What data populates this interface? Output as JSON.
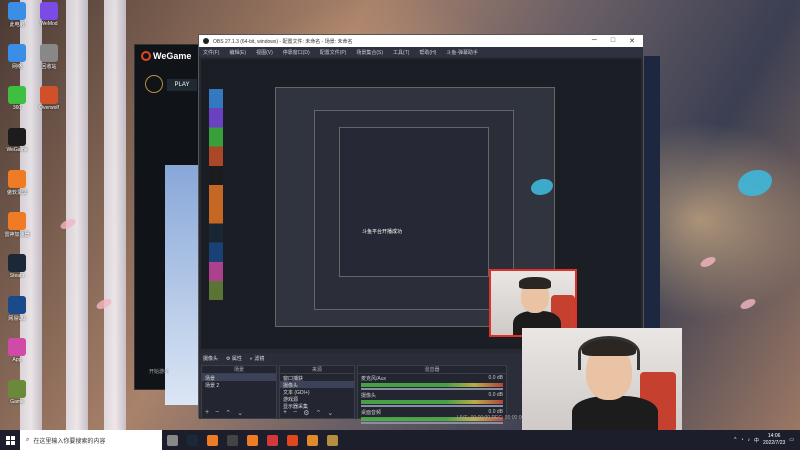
{
  "desktop": {
    "icons": [
      {
        "label": "此电脑",
        "icon": "computer-icon",
        "color": "#3a8ee6"
      },
      {
        "label": "WeMod",
        "icon": "wemod-icon",
        "color": "#7b4be6"
      },
      {
        "label": "网络",
        "icon": "network-icon",
        "color": "#3a8ee6"
      },
      {
        "label": "回收站",
        "icon": "recycle-bin-icon",
        "color": "#888"
      },
      {
        "label": "360",
        "icon": "security-icon",
        "color": "#3fbf3f"
      },
      {
        "label": "Overwolf",
        "icon": "overwolf-icon",
        "color": "#d0502a"
      },
      {
        "label": "WeGame",
        "icon": "wegame-icon",
        "color": "#1c1c1c"
      },
      {
        "label": "傲软录屏",
        "icon": "recorder-icon",
        "color": "#ef7b24"
      },
      {
        "label": "雷神加速器",
        "icon": "booster-icon",
        "color": "#ef7b24"
      },
      {
        "label": "Steam",
        "icon": "steam-icon",
        "color": "#1b2838"
      },
      {
        "label": "网易UU",
        "icon": "uu-icon",
        "color": "#1a4a8a"
      },
      {
        "label": "App",
        "icon": "app-icon",
        "color": "#d04aa8"
      },
      {
        "label": "Game",
        "icon": "game-icon",
        "color": "#6a8a3a"
      }
    ]
  },
  "wegame": {
    "logo": "WeGame",
    "play_label": "PLAY",
    "footer": "开始游戏"
  },
  "obs": {
    "title": "OBS 27.1.3 (64-bit, windows) - 配置文件: 未命名 - 场景: 未命名",
    "menu": [
      "文件(F)",
      "编辑(E)",
      "视图(V)",
      "停靠窗口(D)",
      "配置文件(P)",
      "场景集合(S)",
      "工具(T)",
      "帮助(H)",
      "斗鱼-弹幕助手"
    ],
    "source_name": "摄像头",
    "toolbar": {
      "properties": "属性",
      "filters": "滤镜"
    },
    "scenes_header": "场景",
    "scenes": [
      "场景",
      "场景 2"
    ],
    "sources_header": "来源",
    "sources": [
      "窗口捕获",
      "摄像头",
      "文本 (GDI+)",
      "游戏源",
      "显示器采集"
    ],
    "mixer_header": "混音器",
    "mixer": [
      {
        "name": "麦克风/Aux",
        "db": "0.0 dB"
      },
      {
        "name": "摄像头",
        "db": "0.0 dB"
      },
      {
        "name": "桌面音频",
        "db": "0.0 dB"
      }
    ],
    "status": "LIVE: 00:00:00  REC: 00:00:00  CPU: 2.3%, 30.00 fps",
    "nested_toast": "斗鱼平台开播成功"
  },
  "taskbar": {
    "search_placeholder": "在这里输入你要搜索的内容",
    "apps": [
      {
        "icon": "task-view-icon",
        "color": "#888"
      },
      {
        "icon": "steam-icon",
        "color": "#1b2838"
      },
      {
        "icon": "booster-icon",
        "color": "#ef7b24"
      },
      {
        "icon": "obs-icon",
        "color": "#444"
      },
      {
        "icon": "recorder-icon",
        "color": "#ef7b24"
      },
      {
        "icon": "browser-icon",
        "color": "#d6383a"
      },
      {
        "icon": "wegame-icon",
        "color": "#e2461c"
      },
      {
        "icon": "game-launcher-icon",
        "color": "#e08a2a"
      },
      {
        "icon": "lol-icon",
        "color": "#b58f3e"
      }
    ],
    "tray_lang": "中",
    "time": "14:06",
    "date": "2022/7/23"
  }
}
